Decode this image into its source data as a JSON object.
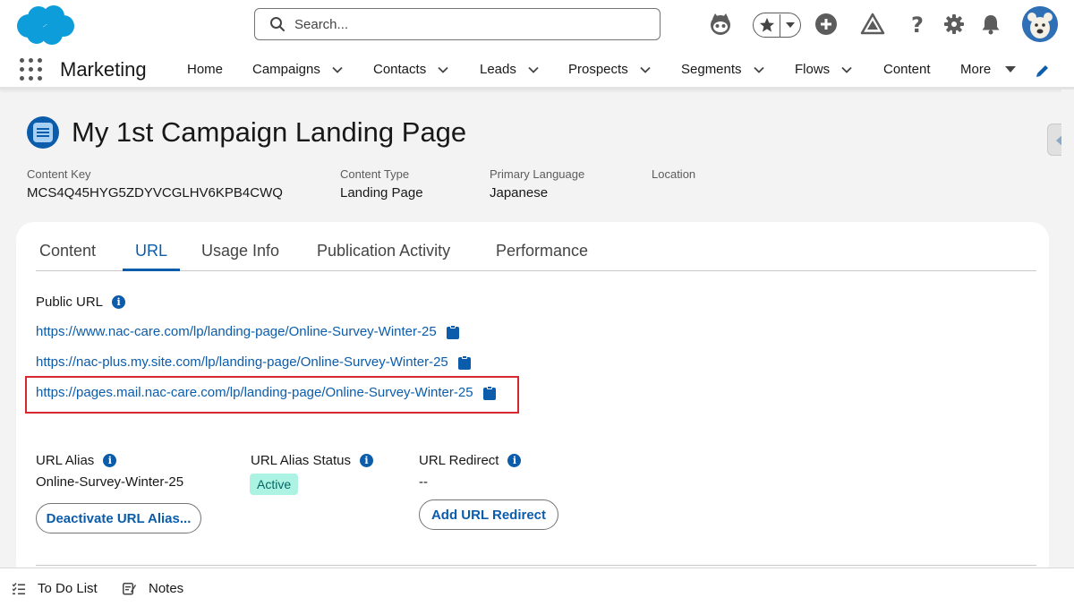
{
  "header": {
    "search_placeholder": "Search...",
    "icons": [
      "salesforce-logo",
      "search-icon",
      "einstein-icon",
      "favorites-star-icon",
      "favorites-dropdown-icon",
      "global-add-icon",
      "trailhead-icon",
      "help-icon",
      "setup-gear-icon",
      "notifications-bell-icon",
      "user-avatar"
    ]
  },
  "nav": {
    "app_name": "Marketing",
    "items": [
      {
        "label": "Home",
        "has_menu": false
      },
      {
        "label": "Campaigns",
        "has_menu": true
      },
      {
        "label": "Contacts",
        "has_menu": true
      },
      {
        "label": "Leads",
        "has_menu": true
      },
      {
        "label": "Prospects",
        "has_menu": true
      },
      {
        "label": "Segments",
        "has_menu": true
      },
      {
        "label": "Flows",
        "has_menu": true
      },
      {
        "label": "Content",
        "has_menu": false
      }
    ],
    "more_label": "More"
  },
  "record": {
    "title": "My 1st Campaign Landing Page",
    "fields": [
      {
        "label": "Content Key",
        "value": "MCS4Q45HYG5ZDYVCGLHV6KPB4CWQ"
      },
      {
        "label": "Content Type",
        "value": "Landing Page"
      },
      {
        "label": "Primary Language",
        "value": "Japanese"
      },
      {
        "label": "Location",
        "value": ""
      }
    ]
  },
  "tabs": [
    {
      "label": "Content",
      "active": false
    },
    {
      "label": "URL",
      "active": true
    },
    {
      "label": "Usage Info",
      "active": false
    },
    {
      "label": "Publication Activity",
      "active": false
    },
    {
      "label": "Performance",
      "active": false
    }
  ],
  "public_url": {
    "label": "Public URL",
    "urls": [
      "https://www.nac-care.com/lp/landing-page/Online-Survey-Winter-25",
      "https://nac-plus.my.site.com/lp/landing-page/Online-Survey-Winter-25",
      "https://pages.mail.nac-care.com/lp/landing-page/Online-Survey-Winter-25"
    ],
    "highlighted_index": 2
  },
  "url_alias": {
    "label": "URL Alias",
    "value": "Online-Survey-Winter-25",
    "deactivate_label": "Deactivate URL Alias..."
  },
  "url_alias_status": {
    "label": "URL Alias Status",
    "value": "Active"
  },
  "url_redirect": {
    "label": "URL Redirect",
    "value": "--",
    "add_label": "Add URL Redirect"
  },
  "utility_bar": {
    "items": [
      {
        "label": "To Do List"
      },
      {
        "label": "Notes"
      }
    ]
  },
  "colors": {
    "brand_blue": "#0b5cab",
    "highlight_red": "#d8282f",
    "status_active_bg": "#acf3e4",
    "status_active_text": "#056764"
  }
}
